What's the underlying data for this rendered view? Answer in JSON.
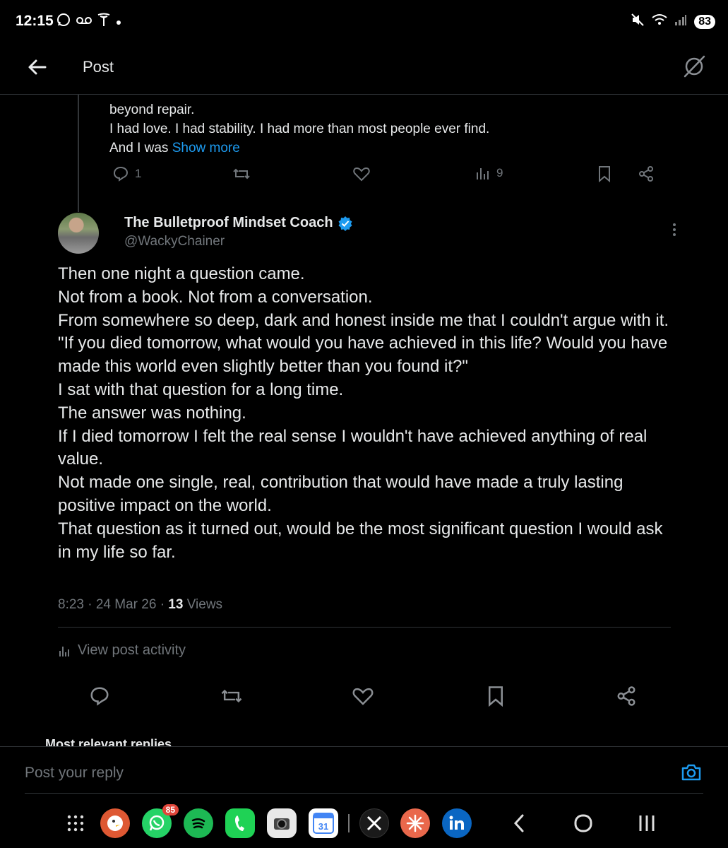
{
  "status_bar": {
    "time": "12:15",
    "battery": "83",
    "left_icons": [
      "whatsapp-icon",
      "voicemail-icon",
      "tesla-icon",
      "dot-icon"
    ],
    "right_icons": [
      "mute-icon",
      "wifi-icon",
      "signal-icon"
    ]
  },
  "header": {
    "title": "Post"
  },
  "previous_reply": {
    "line1": "beyond repair.",
    "line2": "I had love. I had stability. I had more than most people ever find.",
    "line3_prefix": "And I was ",
    "show_more": "Show more",
    "reply_count": "1",
    "views_count": "9"
  },
  "post": {
    "author_name": "The Bulletproof Mindset Coach",
    "author_handle": "@WackyChainer",
    "lines": [
      "Then one night a question came.",
      "Not from a book. Not from a conversation.",
      "From somewhere so deep, dark and honest inside me that I couldn't argue with it.",
      "\"If you died tomorrow, what would you have achieved in this life? Would you have made this world even slightly better than you found it?\"",
      "I sat with that question for a long time.",
      "The answer was nothing.",
      "If I died tomorrow I felt the real sense I wouldn't have achieved anything of real value.",
      "Not made one single, real, contribution that would have made a truly lasting positive impact on the world.",
      "That question as it turned out, would be the most significant question I would ask in my life so far."
    ],
    "timestamp": "8:23 · 24 Mar 26 · ",
    "views_number": "13",
    "views_label": " Views",
    "view_activity": "View post activity"
  },
  "replies_sort": "Most relevant replies",
  "reply_bar": {
    "placeholder": "Post your reply"
  },
  "dock": {
    "whatsapp_badge": "85",
    "calendar_day": "31"
  },
  "colors": {
    "background": "#000000",
    "text": "#e7e9ea",
    "muted": "#71767b",
    "link": "#1d9bf0",
    "verified": "#1d9bf0"
  }
}
